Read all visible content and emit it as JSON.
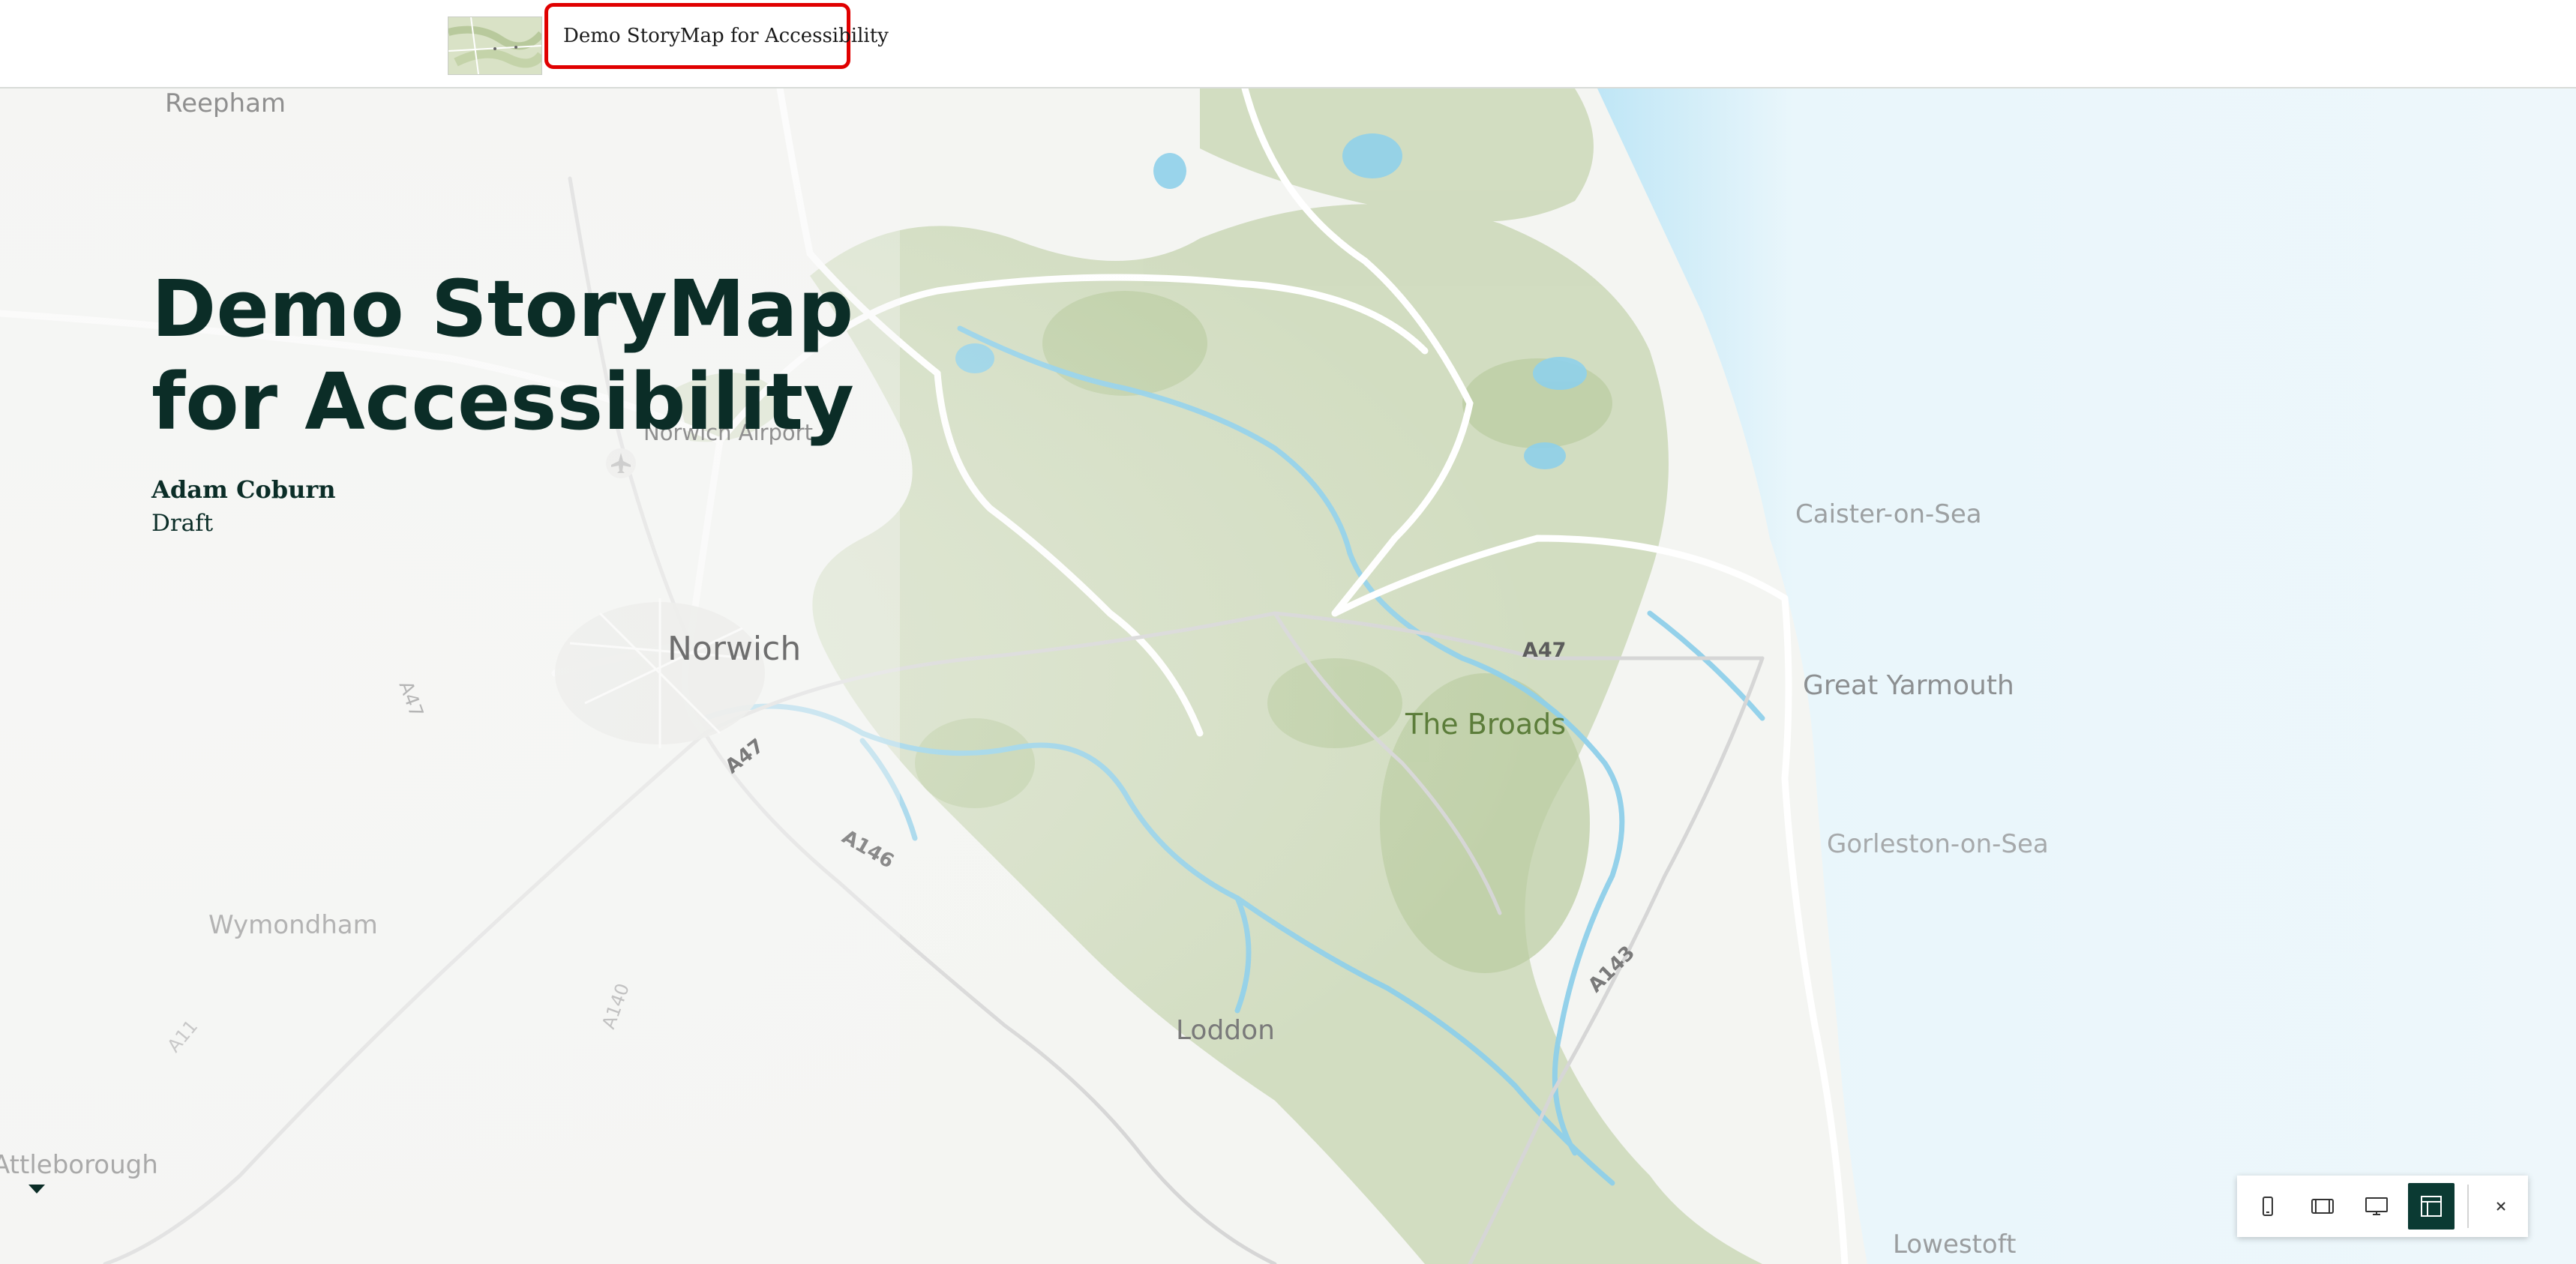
{
  "header": {
    "title": "Demo StoryMap for Accessibility"
  },
  "hero": {
    "title_line1": "Demo StoryMap",
    "title_line2": "for Accessibility",
    "author": "Adam Coburn",
    "status": "Draft"
  },
  "map": {
    "labels": {
      "reepham": "Reepham",
      "norwich_airport": "Norwich Airport",
      "norwich": "Norwich",
      "a47_west": "A47",
      "a47_mid": "A47",
      "a47_east": "A47",
      "a146": "A146",
      "a140": "A140",
      "a11": "A11",
      "a143": "A143",
      "the_broads": "The Broads",
      "caister": "Caister-on-Sea",
      "great_yarmouth": "Great Yarmouth",
      "gorleston": "Gorleston-on-Sea",
      "wymondham": "Wymondham",
      "loddon": "Loddon",
      "attleborough": "Attleborough",
      "lowestoft": "Lowestoft"
    },
    "colors": {
      "land": "#f4f5f2",
      "green": "#c9d6b6",
      "water": "#8fd0ea",
      "sea": "#e6f4f9",
      "road": "#ffffff",
      "broads_label": "#5c7d3a"
    }
  },
  "toolbar": {
    "icons": [
      "mobile-icon",
      "tablet-icon",
      "desktop-icon",
      "layout-icon",
      "close-icon"
    ],
    "active": "layout-icon",
    "accent": "#0b3a33"
  }
}
